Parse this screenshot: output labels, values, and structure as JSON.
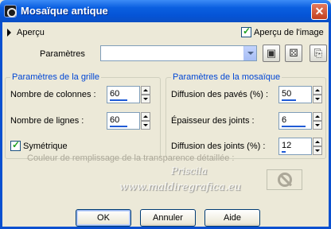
{
  "window": {
    "title": "Mosaïque antique",
    "close_glyph": "✕"
  },
  "preview": {
    "label": "Aperçu",
    "image_preview_label": "Aperçu de l'image",
    "image_preview_checked": true
  },
  "params": {
    "label": "Paramètres",
    "value": ""
  },
  "grid_group": {
    "title": "Paramètres de la grille",
    "columns_label": "Nombre de colonnes :",
    "columns_value": "60",
    "rows_label": "Nombre de lignes :",
    "rows_value": "60",
    "symmetric_label": "Symétrique",
    "symmetric_checked": true
  },
  "mosaic_group": {
    "title": "Paramètres de la mosaïque",
    "tile_diffusion_label": "Diffusion des pavés (%) :",
    "tile_diffusion_value": "50",
    "joint_thickness_label": "Épaisseur des joints :",
    "joint_thickness_value": "6",
    "joint_diffusion_label": "Diffusion des joints (%) :",
    "joint_diffusion_value": "12"
  },
  "fill": {
    "label": "Couleur de remplissage de la transparence détaillée :"
  },
  "watermark": {
    "line1": "Priscila",
    "line2": "www.maldiregrafica.eu"
  },
  "buttons": {
    "ok": "OK",
    "cancel": "Annuler",
    "help": "Aide"
  },
  "colors": {
    "title_bar": "#0554d6",
    "group_title": "#0046d5",
    "dialog_bg": "#ece9d8"
  }
}
